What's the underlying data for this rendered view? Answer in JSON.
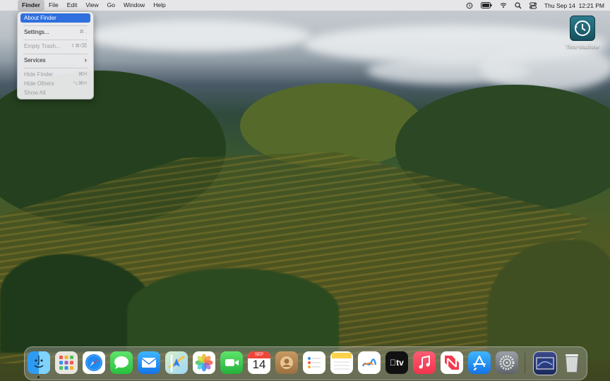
{
  "menubar": {
    "apple_glyph": "",
    "app_name": "Finder",
    "menus": [
      "File",
      "Edit",
      "View",
      "Go",
      "Window",
      "Help"
    ],
    "clock": "Thu Sep 14  12:21 PM",
    "status_icons": [
      "time-machine-icon",
      "battery-icon",
      "wifi-icon",
      "search-icon",
      "control-center-icon"
    ]
  },
  "finder_menu": {
    "about": "About Finder",
    "settings": "Settings...",
    "settings_shortcut": "⌘ ,",
    "empty_trash": "Empty Trash...",
    "empty_trash_shortcut": "⇧⌘⌫",
    "services": "Services",
    "services_arrow": "›",
    "hide_finder": "Hide Finder",
    "hide_finder_shortcut": "⌘H",
    "hide_others": "Hide Others",
    "hide_others_shortcut": "⌥⌘H",
    "show_all": "Show All"
  },
  "desktop": {
    "time_machine_label": "Time Machine"
  },
  "dock": {
    "apps": [
      "Finder",
      "Launchpad",
      "Safari",
      "Messages",
      "Mail",
      "Maps",
      "Photos",
      "FaceTime",
      "Calendar",
      "Contacts",
      "Reminders",
      "Notes",
      "Freeform",
      "TV",
      "Music",
      "News",
      "App Store",
      "System Settings"
    ],
    "calendar_month": "SEP",
    "calendar_day": "14",
    "tv_label": "tv",
    "right_items": [
      "Downloads",
      "Trash"
    ]
  }
}
